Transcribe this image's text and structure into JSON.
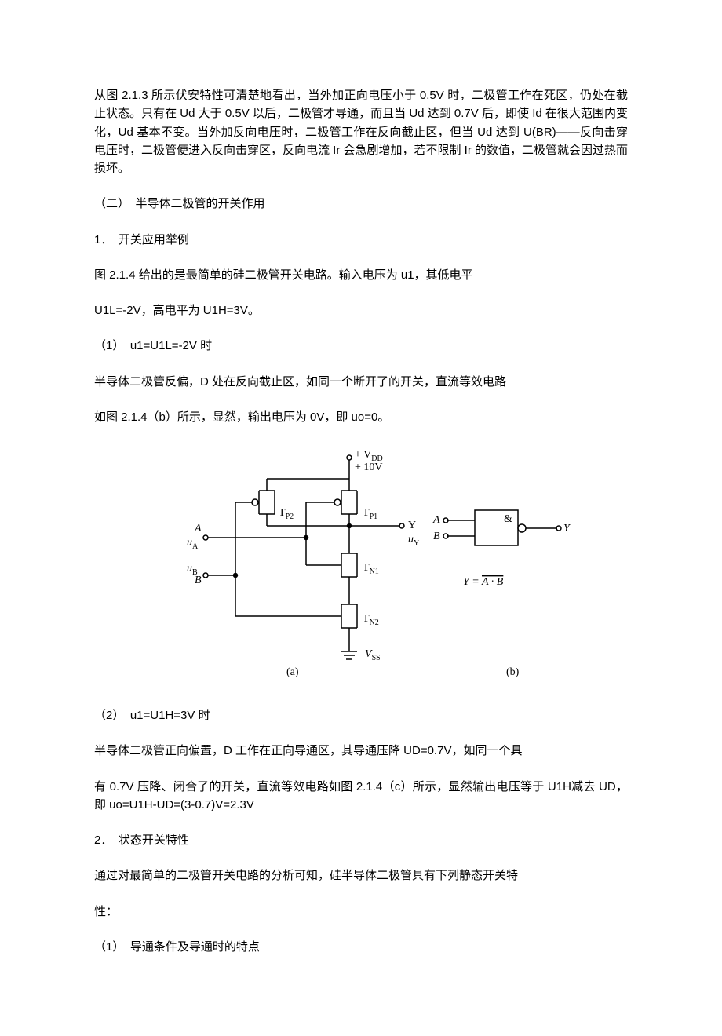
{
  "p1": "从图 2.1.3 所示伏安特性可清楚地看出，当外加正向电压小于 0.5V 时，二极管工作在死区，仍处在截止状态。只有在 Ud 大于 0.5V 以后，二极管才导通，而且当 Ud 达到 0.7V 后，即使 Id 在很大范围内变化，Ud 基本不变。当外加反向电压时，二极管工作在反向截止区，但当 Ud 达到 U(BR)——反向击穿电压时，二极管便进入反向击穿区，反向电流 Ir 会急剧增加，若不限制 Ir 的数值，二极管就会因过热而损坏。",
  "p2": "（二）　半导体二极管的开关作用",
  "p3": "1．　开关应用举例",
  "p4": "图 2.1.4 给出的是最简单的硅二极管开关电路。输入电压为 u1，其低电平",
  "p5": "U1L=-2V，高电平为 U1H=3V。",
  "p6": "（1）　u1=U1L=-2V 时",
  "p7": "半导体二极管反偏，D 处在反向截止区，如同一个断开了的开关，直流等效电路",
  "p8": "如图 2.1.4（b）所示，显然，输出电压为 0V，即 uo=0。",
  "p9": "（2）　u1=U1H=3V 时",
  "p10": "半导体二极管正向偏置，D 工作在正向导通区，其导通压降 UD=0.7V，如同一个具",
  "p11": "有 0.7V 压降、闭合了的开关，直流等效电路如图 2.1.4（c）所示，显然输出电压等于 U1H减去 UD，即 uo=U1H-UD=(3-0.7)V=2.3V",
  "p12": "2．　状态开关特性",
  "p13": "通过对最简单的二极管开关电路的分析可知，硅半导体二极管具有下列静态开关特",
  "p14": "性：",
  "p15": "（1）　导通条件及导通时的特点",
  "fig": {
    "vdd_top": "+ V",
    "vdd_sub": "DD",
    "v10": "+ 10V",
    "A": "A",
    "uA": "u",
    "uAsub": "A",
    "B": "B",
    "uB": "u",
    "uBsub": "B",
    "Y": "Y",
    "uY": "u",
    "uYsub": "Y",
    "TP1": "T",
    "TP1s": "P1",
    "TP2": "T",
    "TP2s": "P2",
    "TN1": "T",
    "TN1s": "N1",
    "TN2": "T",
    "TN2s": "N2",
    "Vss": "V",
    "Vsss": "SS",
    "labA": "(a)",
    "labB": "(b)",
    "symA": "A",
    "symB": "B",
    "symY": "Y",
    "amp": "&",
    "eqY": "Y = ",
    "eqAB": "A · B"
  }
}
